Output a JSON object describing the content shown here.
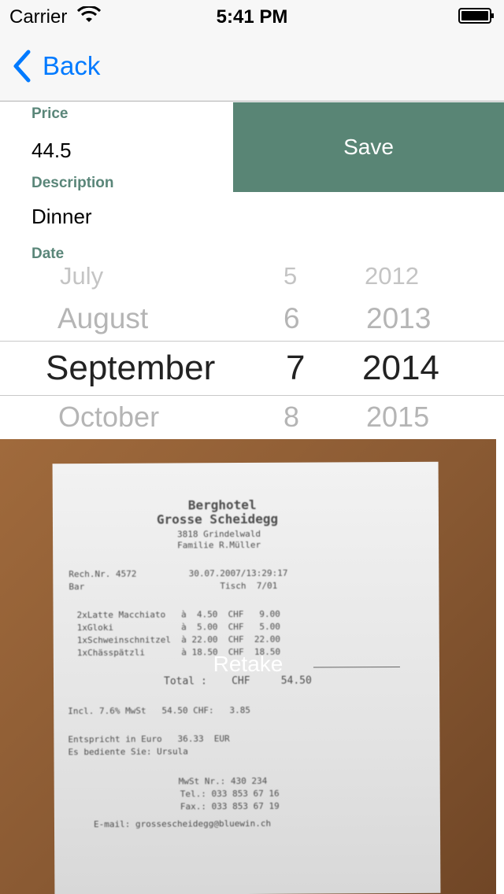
{
  "status": {
    "carrier": "Carrier",
    "time": "5:41 PM"
  },
  "nav": {
    "back_label": "Back"
  },
  "form": {
    "price_label": "Price",
    "price_value": "44.5",
    "description_label": "Description",
    "description_value": "Dinner",
    "date_label": "Date",
    "save_label": "Save"
  },
  "picker": {
    "months": [
      "July",
      "August",
      "September",
      "October"
    ],
    "days": [
      "5",
      "6",
      "7",
      "8"
    ],
    "years": [
      "2012",
      "2013",
      "2014",
      "2015"
    ],
    "selected_index": 2
  },
  "photo": {
    "retake_label": "Retake",
    "receipt_lines": [
      "Berghotel",
      "Grosse Scheidegg",
      "3818 Grindelwald",
      "Familie R.Müller",
      "Rech.Nr. 4572          30.07.2007/13:29:17",
      "Bar                          Tisch  7/01",
      "2xLatte Macchiato   à  4.50  CHF   9.00",
      "1xGloki             à  5.00  CHF   5.00",
      "1xSchweinschnitzel  à 22.00  CHF  22.00",
      "1xChässpätzli       à 18.50  CHF  18.50",
      "Total :    CHF     54.50",
      "Incl. 7.6% MwSt   54.50 CHF:   3.85",
      "Entspricht in Euro   36.33  EUR",
      "Es bediente Sie: Ursula",
      "MwSt Nr.: 430 234",
      "Tel.: 033 853 67 16",
      "Fax.: 033 853 67 19",
      "E-mail: grossescheidegg@bluewin.ch"
    ]
  },
  "colors": {
    "accent": "#007aff",
    "brand": "#598575",
    "label": "#5a8679"
  }
}
